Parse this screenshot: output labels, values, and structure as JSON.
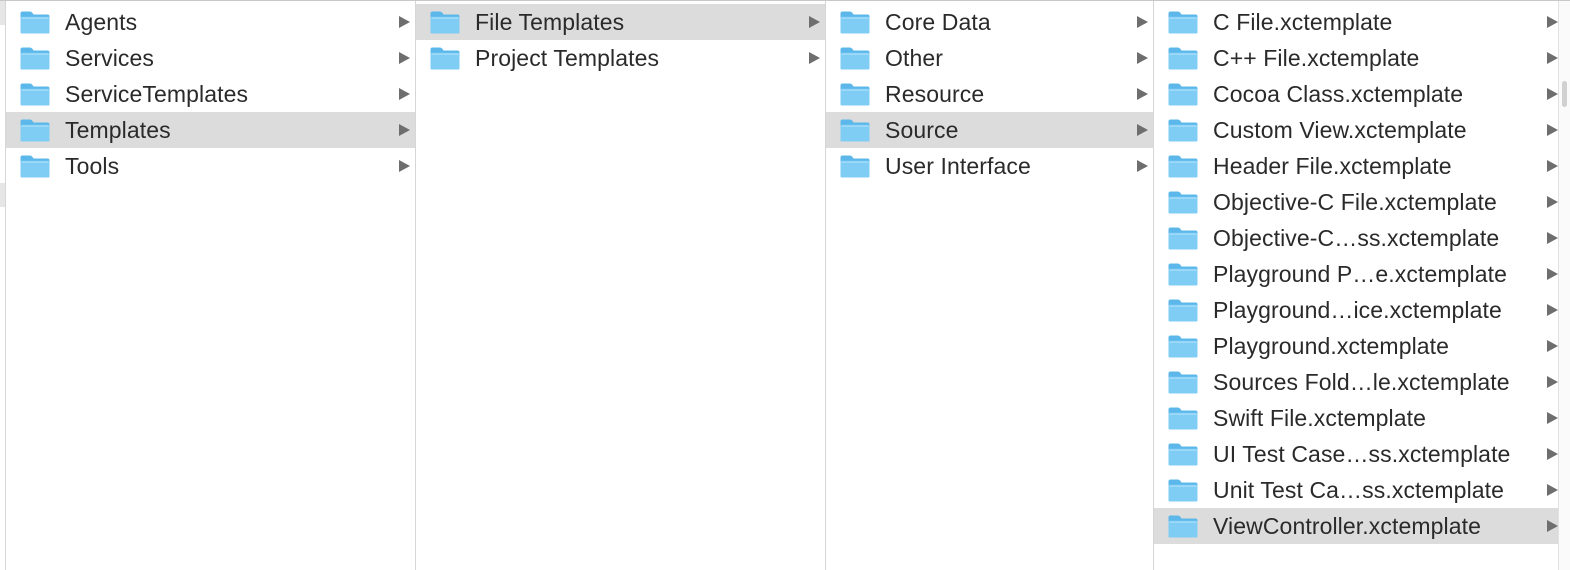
{
  "columns": [
    {
      "items": [
        {
          "label": "Agents",
          "selected": false
        },
        {
          "label": "Services",
          "selected": false
        },
        {
          "label": "ServiceTemplates",
          "selected": false
        },
        {
          "label": "Templates",
          "selected": true
        },
        {
          "label": "Tools",
          "selected": false
        }
      ]
    },
    {
      "items": [
        {
          "label": "File Templates",
          "selected": true
        },
        {
          "label": "Project Templates",
          "selected": false
        }
      ]
    },
    {
      "items": [
        {
          "label": "Core Data",
          "selected": false
        },
        {
          "label": "Other",
          "selected": false
        },
        {
          "label": "Resource",
          "selected": false
        },
        {
          "label": "Source",
          "selected": true
        },
        {
          "label": "User Interface",
          "selected": false
        }
      ]
    },
    {
      "items": [
        {
          "label": "C File.xctemplate",
          "selected": false
        },
        {
          "label": "C++ File.xctemplate",
          "selected": false
        },
        {
          "label": "Cocoa Class.xctemplate",
          "selected": false
        },
        {
          "label": "Custom View.xctemplate",
          "selected": false
        },
        {
          "label": "Header File.xctemplate",
          "selected": false
        },
        {
          "label": "Objective-C File.xctemplate",
          "selected": false
        },
        {
          "label": "Objective-C…ss.xctemplate",
          "selected": false
        },
        {
          "label": "Playground P…e.xctemplate",
          "selected": false
        },
        {
          "label": "Playground…ice.xctemplate",
          "selected": false
        },
        {
          "label": "Playground.xctemplate",
          "selected": false
        },
        {
          "label": "Sources Fold…le.xctemplate",
          "selected": false
        },
        {
          "label": "Swift File.xctemplate",
          "selected": false
        },
        {
          "label": "UI Test Case…ss.xctemplate",
          "selected": false
        },
        {
          "label": "Unit Test Ca…ss.xctemplate",
          "selected": false
        },
        {
          "label": "ViewController.xctemplate",
          "selected": true
        }
      ]
    }
  ],
  "icons": {
    "item_icon": "folder-icon",
    "disclosure_icon": "disclosure-arrow-icon"
  },
  "colors": {
    "selection": "#dcdcdc",
    "folder_body": "#7fcdf5",
    "folder_tab": "#5cb8ea",
    "text": "#2a2a2a",
    "arrow": "#6e6e6e"
  }
}
